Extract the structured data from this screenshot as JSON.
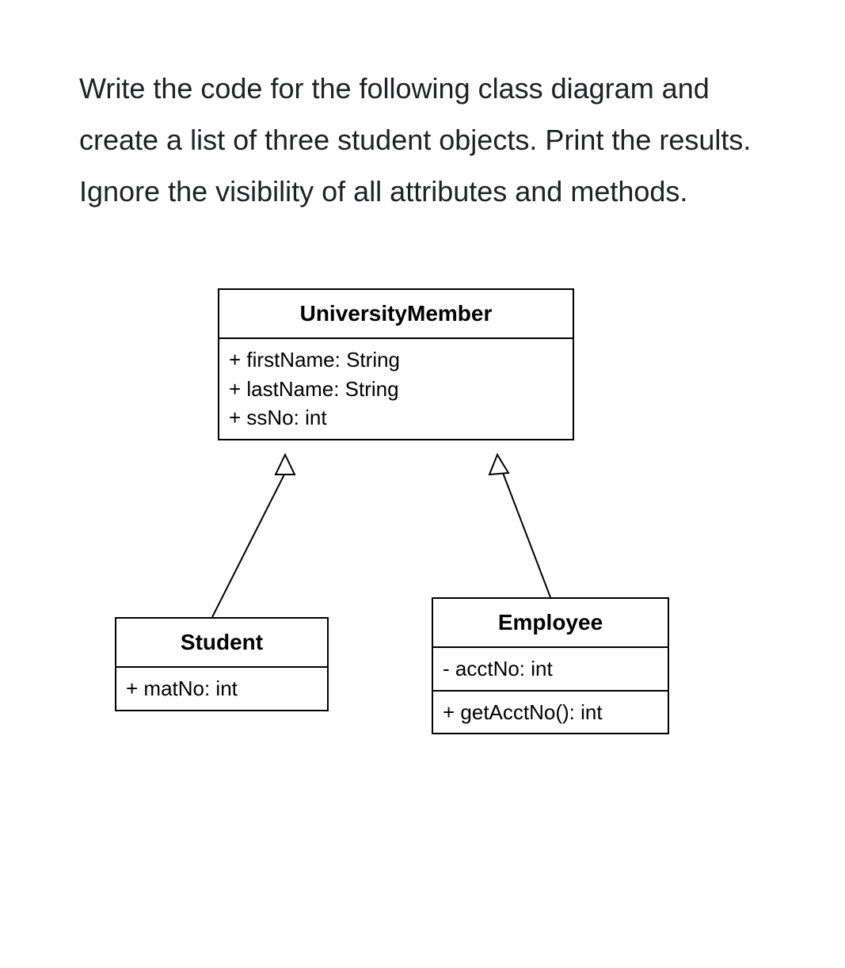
{
  "prompt": {
    "text": "Write the code for the following class diagram and create a list of three student objects. Print the results. Ignore the visibility of all attributes and methods."
  },
  "diagram": {
    "parent": {
      "name": "UniversityMember",
      "attributes": [
        "+ firstName: String",
        "+ lastName: String",
        "+ ssNo: int"
      ]
    },
    "student": {
      "name": "Student",
      "attributes": [
        "+ matNo: int"
      ]
    },
    "employee": {
      "name": "Employee",
      "attributes": [
        "- acctNo: int"
      ],
      "methods": [
        "+ getAcctNo(): int"
      ]
    }
  }
}
